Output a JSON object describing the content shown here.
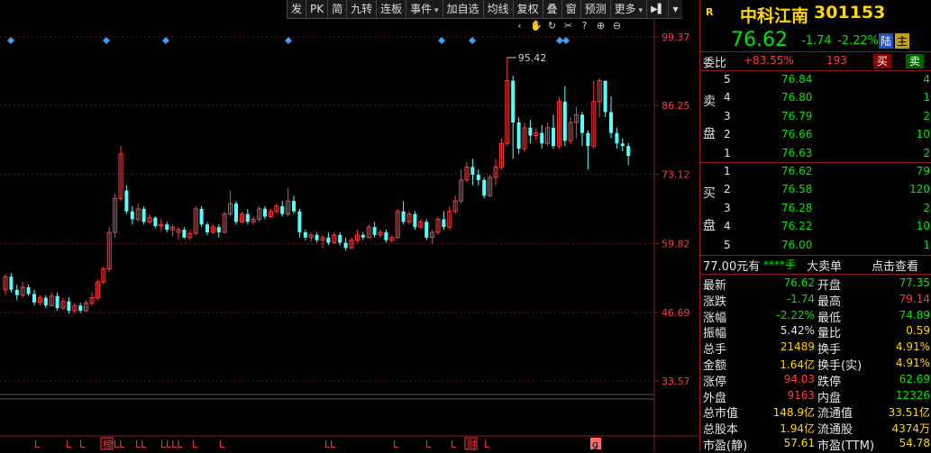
{
  "toolbar": {
    "items": [
      "发",
      "PK",
      "简",
      "九转",
      "连板",
      "事件",
      "加自选",
      "均线",
      "复权",
      "叠",
      "窗",
      "预测",
      "更多"
    ],
    "dropdown_indices": [
      5,
      12
    ]
  },
  "chart": {
    "peak_label": "95.42",
    "price_axis": [
      "99.37",
      "86.25",
      "73.12",
      "59.82",
      "46.69",
      "33.57"
    ],
    "bottom_markers": [
      "L",
      "L",
      "L",
      "榜",
      "LL",
      "LL",
      "LLLL",
      "L",
      "L",
      "LL",
      "L",
      "L",
      "L",
      "财",
      "L",
      "g"
    ]
  },
  "quote": {
    "badge": "R",
    "name": "中科江南",
    "code": "301153",
    "price": "76.62",
    "change": "-1.74",
    "pct": "-2.22%",
    "exchange": "陆",
    "margin": "主"
  },
  "weibi": {
    "label": "委比",
    "value": "+83.55%",
    "diff": "193",
    "buy": "买",
    "sell": "卖"
  },
  "sell_side_label": [
    "卖",
    "盘"
  ],
  "buy_side_label": [
    "买",
    "盘"
  ],
  "asks": [
    {
      "level": "5",
      "price": "76.84",
      "vol": "4"
    },
    {
      "level": "4",
      "price": "76.80",
      "vol": "1"
    },
    {
      "level": "3",
      "price": "76.79",
      "vol": "2"
    },
    {
      "level": "2",
      "price": "76.66",
      "vol": "10"
    },
    {
      "level": "1",
      "price": "76.63",
      "vol": "2"
    }
  ],
  "bids": [
    {
      "level": "1",
      "price": "76.62",
      "vol": "79"
    },
    {
      "level": "2",
      "price": "76.58",
      "vol": "120"
    },
    {
      "level": "3",
      "price": "76.28",
      "vol": "2"
    },
    {
      "level": "4",
      "price": "76.22",
      "vol": "10"
    },
    {
      "level": "5",
      "price": "76.00",
      "vol": "1"
    }
  ],
  "bigorder": {
    "price_text": "77.00元有",
    "vol_text": "****手",
    "title": "大卖单",
    "action": "点击查看"
  },
  "stats": [
    {
      "l1": "最新",
      "v1": "76.62",
      "c1": "g",
      "l2": "开盘",
      "v2": "77.35",
      "c2": "g"
    },
    {
      "l1": "涨跌",
      "v1": "-1.74",
      "c1": "g",
      "l2": "最高",
      "v2": "79.14",
      "c2": "r"
    },
    {
      "l1": "涨幅",
      "v1": "-2.22%",
      "c1": "g",
      "l2": "最低",
      "v2": "74.89",
      "c2": "g"
    },
    {
      "l1": "振幅",
      "v1": "5.42%",
      "c1": "w",
      "l2": "量比",
      "v2": "0.59",
      "c2": "y"
    },
    {
      "l1": "总手",
      "v1": "21489",
      "c1": "y",
      "l2": "换手",
      "v2": "4.91%",
      "c2": "y"
    },
    {
      "l1": "金额",
      "v1": "1.64亿",
      "c1": "y",
      "l2": "换手(实)",
      "v2": "4.91%",
      "c2": "y"
    },
    {
      "l1": "涨停",
      "v1": "94.03",
      "c1": "r",
      "l2": "跌停",
      "v2": "62.69",
      "c2": "g"
    },
    {
      "l1": "外盘",
      "v1": "9163",
      "c1": "r",
      "l2": "内盘",
      "v2": "12326",
      "c2": "g"
    },
    {
      "l1": "总市值",
      "v1": "148.9亿",
      "c1": "y",
      "l2": "流通值",
      "v2": "33.51亿",
      "c2": "y"
    },
    {
      "l1": "总股本",
      "v1": "1.94亿",
      "c1": "y",
      "l2": "流通股",
      "v2": "4374万",
      "c2": "y"
    },
    {
      "l1": "市盈(静)",
      "v1": "57.61",
      "c1": "y",
      "l2": "市盈(TTM)",
      "v2": "54.78",
      "c2": "y"
    }
  ],
  "chart_data": {
    "type": "candlestick",
    "y_axis_ticks": [
      99.37,
      86.25,
      73.12,
      59.82,
      46.69,
      33.57
    ],
    "peak": 95.42,
    "candles": [
      [
        51.0,
        53.5,
        50.0,
        54.0
      ],
      [
        53.5,
        51.0,
        50.5,
        54.2
      ],
      [
        51.0,
        50.0,
        49.0,
        52.0
      ],
      [
        50.0,
        51.5,
        49.5,
        52.5
      ],
      [
        51.5,
        50.2,
        49.8,
        52.0
      ],
      [
        50.2,
        48.6,
        48.0,
        51.0
      ],
      [
        48.6,
        49.5,
        48.0,
        50.0
      ],
      [
        49.5,
        48.0,
        47.5,
        50.0
      ],
      [
        48.0,
        49.8,
        47.8,
        50.5
      ],
      [
        49.8,
        47.5,
        47.0,
        50.5
      ],
      [
        47.5,
        48.8,
        47.2,
        49.5
      ],
      [
        48.8,
        47.0,
        46.5,
        49.5
      ],
      [
        47.0,
        48.0,
        46.5,
        48.5
      ],
      [
        48.0,
        47.0,
        46.6,
        48.5
      ],
      [
        47.0,
        48.5,
        46.8,
        49.0
      ],
      [
        48.5,
        49.5,
        48.0,
        50.5
      ],
      [
        49.5,
        52.5,
        49.0,
        53.0
      ],
      [
        52.5,
        55.0,
        52.0,
        55.5
      ],
      [
        55.0,
        62.0,
        54.5,
        63.0
      ],
      [
        62.0,
        68.5,
        61.0,
        69.5
      ],
      [
        68.5,
        77.0,
        68.0,
        78.5
      ],
      [
        70.0,
        66.0,
        65.5,
        71.0
      ],
      [
        66.0,
        64.5,
        63.5,
        67.0
      ],
      [
        64.5,
        66.5,
        64.0,
        67.5
      ],
      [
        66.5,
        64.0,
        63.5,
        67.0
      ],
      [
        64.0,
        64.8,
        63.6,
        65.5
      ],
      [
        64.8,
        63.2,
        62.8,
        65.0
      ],
      [
        63.2,
        63.5,
        62.2,
        64.5
      ],
      [
        63.5,
        62.5,
        62.0,
        64.0
      ],
      [
        62.5,
        63.0,
        61.2,
        63.5
      ],
      [
        62.0,
        62.5,
        60.5,
        63.0
      ],
      [
        62.5,
        61.0,
        60.8,
        63.0
      ],
      [
        61.0,
        61.8,
        60.5,
        62.5
      ],
      [
        61.8,
        66.5,
        61.5,
        67.0
      ],
      [
        66.5,
        63.5,
        63.0,
        67.0
      ],
      [
        63.5,
        62.0,
        61.5,
        64.0
      ],
      [
        62.0,
        63.0,
        61.6,
        63.5
      ],
      [
        63.0,
        62.0,
        61.0,
        63.5
      ],
      [
        62.0,
        65.5,
        61.8,
        66.0
      ],
      [
        65.5,
        67.5,
        65.0,
        70.0
      ],
      [
        67.5,
        64.0,
        63.5,
        68.0
      ],
      [
        64.0,
        65.5,
        63.8,
        66.0
      ],
      [
        65.5,
        64.0,
        63.5,
        66.5
      ],
      [
        64.0,
        64.5,
        63.5,
        65.0
      ],
      [
        64.5,
        66.5,
        64.0,
        67.0
      ],
      [
        66.5,
        65.0,
        64.5,
        67.0
      ],
      [
        65.0,
        66.0,
        64.8,
        66.5
      ],
      [
        66.0,
        67.0,
        65.5,
        67.5
      ],
      [
        67.0,
        65.5,
        65.0,
        68.0
      ],
      [
        65.5,
        68.0,
        65.0,
        70.5
      ],
      [
        68.0,
        66.0,
        65.5,
        69.0
      ],
      [
        66.0,
        62.0,
        61.0,
        66.5
      ],
      [
        62.0,
        61.0,
        60.5,
        62.5
      ],
      [
        61.0,
        61.5,
        60.2,
        62.0
      ],
      [
        61.5,
        60.5,
        60.0,
        62.0
      ],
      [
        60.5,
        61.0,
        59.0,
        61.5
      ],
      [
        61.0,
        60.0,
        59.5,
        62.0
      ],
      [
        60.0,
        61.5,
        59.8,
        62.0
      ],
      [
        61.5,
        60.0,
        59.5,
        62.0
      ],
      [
        60.0,
        59.0,
        58.5,
        61.0
      ],
      [
        59.0,
        60.5,
        58.8,
        61.0
      ],
      [
        60.5,
        61.5,
        60.0,
        62.5
      ],
      [
        61.5,
        61.0,
        60.5,
        62.0
      ],
      [
        61.0,
        63.0,
        60.8,
        63.5
      ],
      [
        63.0,
        61.5,
        61.0,
        64.0
      ],
      [
        61.5,
        62.0,
        61.0,
        62.5
      ],
      [
        62.0,
        60.5,
        60.0,
        62.5
      ],
      [
        60.5,
        61.0,
        60.0,
        61.5
      ],
      [
        61.0,
        66.0,
        60.8,
        66.5
      ],
      [
        66.0,
        64.0,
        63.5,
        68.0
      ],
      [
        64.0,
        65.5,
        63.5,
        66.0
      ],
      [
        65.5,
        63.0,
        62.5,
        66.0
      ],
      [
        63.0,
        64.0,
        62.8,
        64.5
      ],
      [
        64.0,
        61.0,
        60.5,
        64.5
      ],
      [
        61.0,
        62.0,
        59.8,
        62.5
      ],
      [
        62.0,
        64.5,
        61.5,
        65.0
      ],
      [
        64.5,
        63.0,
        62.5,
        66.0
      ],
      [
        63.0,
        66.0,
        62.5,
        67.0
      ],
      [
        66.0,
        68.0,
        65.5,
        69.0
      ],
      [
        68.0,
        72.0,
        67.5,
        74.0
      ],
      [
        72.0,
        74.5,
        71.5,
        75.5
      ],
      [
        74.5,
        73.0,
        71.0,
        76.0
      ],
      [
        73.0,
        72.0,
        71.0,
        74.0
      ],
      [
        72.0,
        69.0,
        68.5,
        72.5
      ],
      [
        69.0,
        72.5,
        68.8,
        73.0
      ],
      [
        72.5,
        74.5,
        71.0,
        76.0
      ],
      [
        74.5,
        79.0,
        74.0,
        80.0
      ],
      [
        79.0,
        91.0,
        78.5,
        95.42
      ],
      [
        91.0,
        83.0,
        76.0,
        92.0
      ],
      [
        83.0,
        78.0,
        77.0,
        84.0
      ],
      [
        78.0,
        82.0,
        77.5,
        83.0
      ],
      [
        82.0,
        80.5,
        79.0,
        83.5
      ],
      [
        80.5,
        81.0,
        79.5,
        82.0
      ],
      [
        81.0,
        79.0,
        78.0,
        82.5
      ],
      [
        79.0,
        82.0,
        78.5,
        83.0
      ],
      [
        82.0,
        78.5,
        78.0,
        84.5
      ],
      [
        78.5,
        87.0,
        78.0,
        88.0
      ],
      [
        87.0,
        79.5,
        78.5,
        90.0
      ],
      [
        79.5,
        83.0,
        78.8,
        84.0
      ],
      [
        83.0,
        84.5,
        80.0,
        86.0
      ],
      [
        84.5,
        81.0,
        78.5,
        85.0
      ],
      [
        81.0,
        78.5,
        74.0,
        81.5
      ],
      [
        78.5,
        87.0,
        78.0,
        91.0
      ],
      [
        87.0,
        91.0,
        84.0,
        91.5
      ],
      [
        91.0,
        85.0,
        84.0,
        90.0
      ],
      [
        85.0,
        81.0,
        80.0,
        88.0
      ],
      [
        81.0,
        79.0,
        78.0,
        82.0
      ],
      [
        79.0,
        78.5,
        77.5,
        80.0
      ],
      [
        78.5,
        76.6,
        74.9,
        79.1
      ]
    ]
  }
}
